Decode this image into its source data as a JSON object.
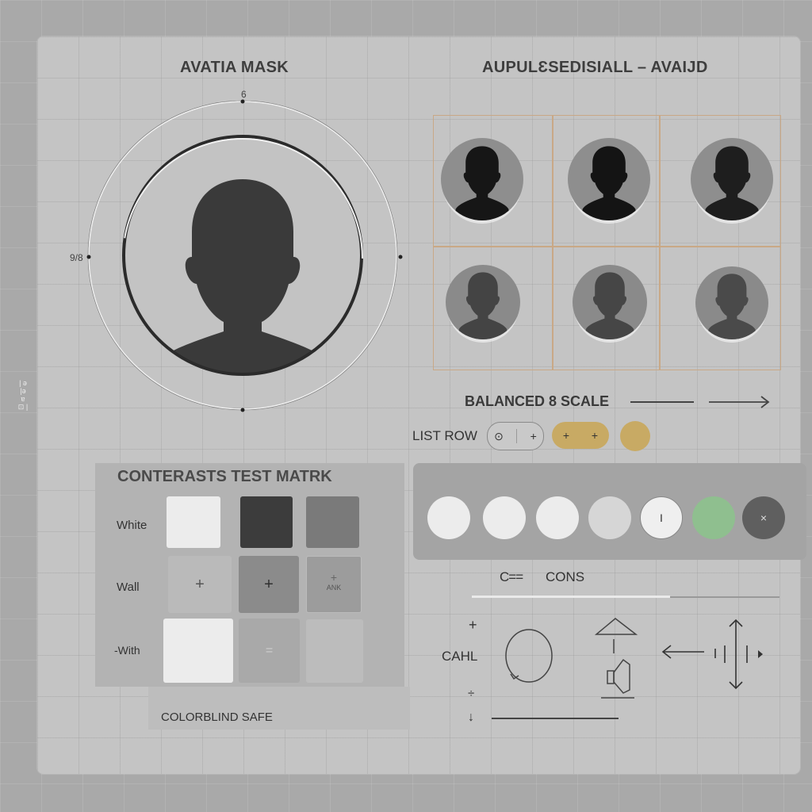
{
  "side_text": "| ǝ |ə ɐ ⊡ |",
  "avatar_mask": {
    "title": "AVATIA MASK",
    "top_mark": "6",
    "left_mark": "9/8"
  },
  "avatar_grid": {
    "title": "AUPULƐSEDISIALL – AVAIJD"
  },
  "balanced_scale": {
    "label": "BALANCED 8 SCALE"
  },
  "list_row": {
    "label": "LIST ROW",
    "pill1": [
      "⊙",
      "+"
    ],
    "pill2": [
      "+",
      "+"
    ]
  },
  "contrast_matrix": {
    "title": "CONTERASTS TEST MATRK",
    "rows": [
      "White",
      "Wall",
      "-With"
    ],
    "cell_text": {
      "row2_col1": "+",
      "row2_col2": "+",
      "row2_col3_top": "+",
      "row2_col3_bottom": "ANK",
      "row3_col2": "="
    }
  },
  "colorblind": {
    "label": "COLORBLIND SAFE"
  },
  "circles_row": {
    "items": [
      "",
      "",
      "",
      "",
      "I",
      "",
      "×"
    ],
    "colors": [
      "#ececec",
      "#ececec",
      "#ececec",
      "#d6d6d6",
      "#efefef",
      "#8fbf8f",
      "#5f5f5f"
    ]
  },
  "icons_section": {
    "label": "CONS",
    "prefix": "C==",
    "cahl_label": "CAHL",
    "plus": "+",
    "tilde": "÷",
    "down": "↓"
  },
  "colors": {
    "accent_gold": "#c8aa64",
    "grid_line": "#c9a886"
  }
}
